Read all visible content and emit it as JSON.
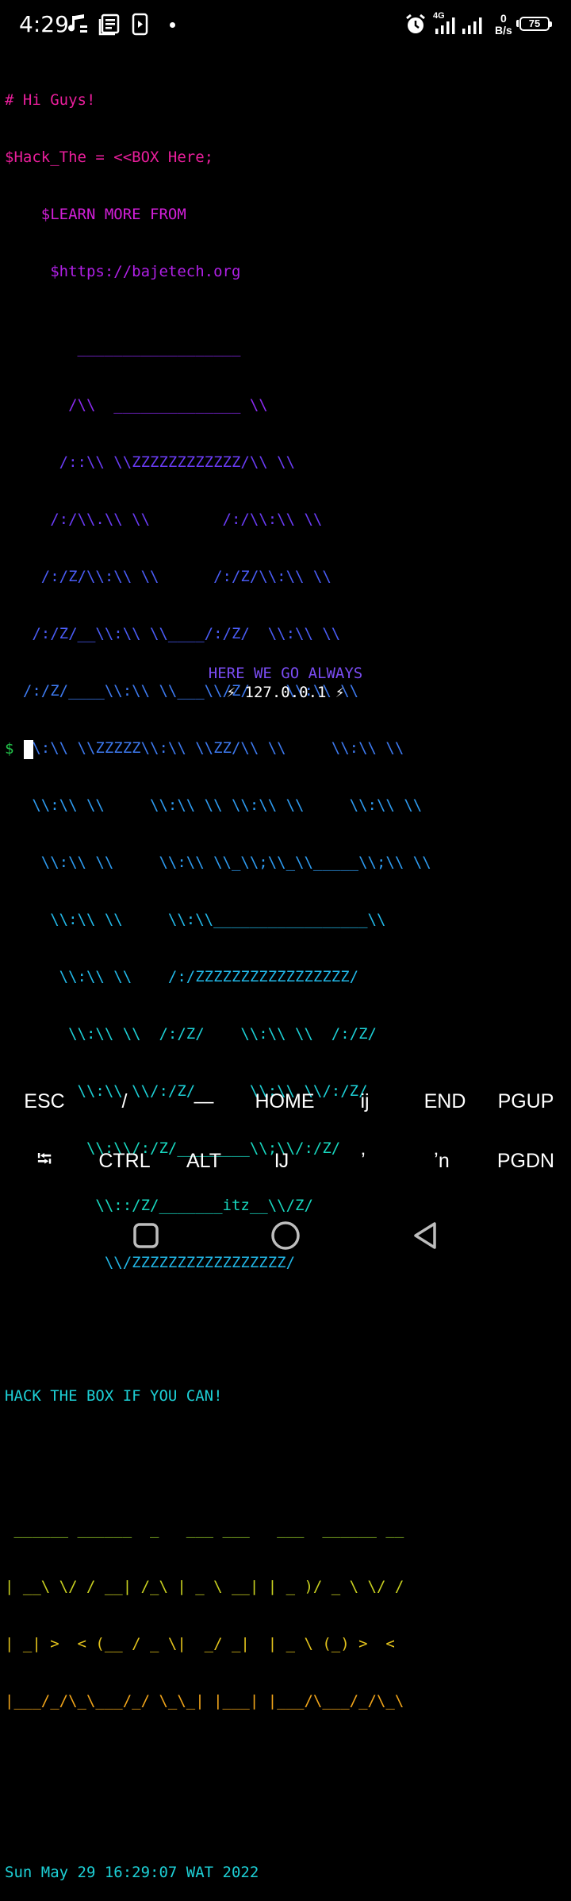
{
  "status_bar": {
    "time": "4:29",
    "network_type": "4G",
    "data_rate_value": "0",
    "data_rate_unit": "B/s",
    "battery": "75",
    "icons": [
      "music-notification-icon",
      "news-notification-icon",
      "media-notification-icon",
      "dot-icon",
      "alarm-icon",
      "signal-4g-icon",
      "signal-icon",
      "battery-icon"
    ]
  },
  "terminal": {
    "motd": [
      "# Hi Guys!",
      "$Hack_The = <<BOX Here;",
      "    $LEARN MORE FROM",
      "     $https://bajetech.org"
    ],
    "cube_art": [
      "        __________________",
      "       /\\\\  ______________ \\\\",
      "      /::\\\\ \\\\ZZZZZZZZZZZZ/\\\\ \\\\",
      "     /:/\\\\.\\\\ \\\\        /:/\\\\:\\\\ \\\\",
      "    /:/Z/\\\\:\\\\ \\\\      /:/Z/\\\\:\\\\ \\\\",
      "   /:/Z/__\\\\:\\\\ \\\\____/:/Z/  \\\\:\\\\ \\\\",
      "  /:/Z/____\\\\:\\\\ \\\\___\\\\/Z/    \\\\:\\\\ \\\\",
      "  \\\\:\\\\ \\\\ZZZZZ\\\\:\\\\ \\\\ZZ/\\\\ \\\\     \\\\:\\\\ \\\\",
      "   \\\\:\\\\ \\\\     \\\\:\\\\ \\\\ \\\\:\\\\ \\\\     \\\\:\\\\ \\\\",
      "    \\\\:\\\\ \\\\     \\\\:\\\\ \\\\_\\\\;\\\\_\\\\_____\\\\;\\\\ \\\\",
      "     \\\\:\\\\ \\\\     \\\\:\\\\_________________\\\\",
      "      \\\\:\\\\ \\\\    /:/ZZZZZZZZZZZZZZZZZ/",
      "       \\\\:\\\\ \\\\  /:/Z/    \\\\:\\\\ \\\\  /:/Z/",
      "        \\\\:\\\\ \\\\/:/Z/      \\\\:\\\\ \\\\/:/Z/",
      "         \\\\:\\\\/:/Z/________\\\\;\\\\/:/Z/",
      "          \\\\::/Z/_______itz__\\\\/Z/",
      "           \\\\/ZZZZZZZZZZZZZZZZZ/"
    ],
    "tagline": "HACK THE BOX IF YOU CAN!",
    "banner_art": [
      " ______ ______  _   ___ ___   ___  ______ __",
      "| __\\ \\/ / __| /_\\ | _ \\ __| | _ )/ _ \\ \\/ /",
      "| _| >  < (__ / _ \\|  _/ _|  | _ \\ (_) >  <",
      "|___/_/\\_\\___/_/ \\_\\_| |___| |___/\\___/_/\\_\\"
    ],
    "date_line": "Sun May 29 16:29:07 WAT 2022",
    "motto": "HERE WE GO ALWAYS",
    "ip_line": "⚡ 127.0.0.1 ⚡",
    "prompt": "$"
  },
  "extra_keys": {
    "row1": [
      "ESC",
      "/",
      "—",
      "HOME",
      "ij",
      "END",
      "PGUP"
    ],
    "row2": [
      "⭾",
      "CTRL",
      "ALT",
      "Ĳ",
      "ʼ",
      "ʼn",
      "PGDN"
    ]
  },
  "nav": {
    "buttons": [
      "recents-button",
      "home-button",
      "back-button"
    ]
  }
}
